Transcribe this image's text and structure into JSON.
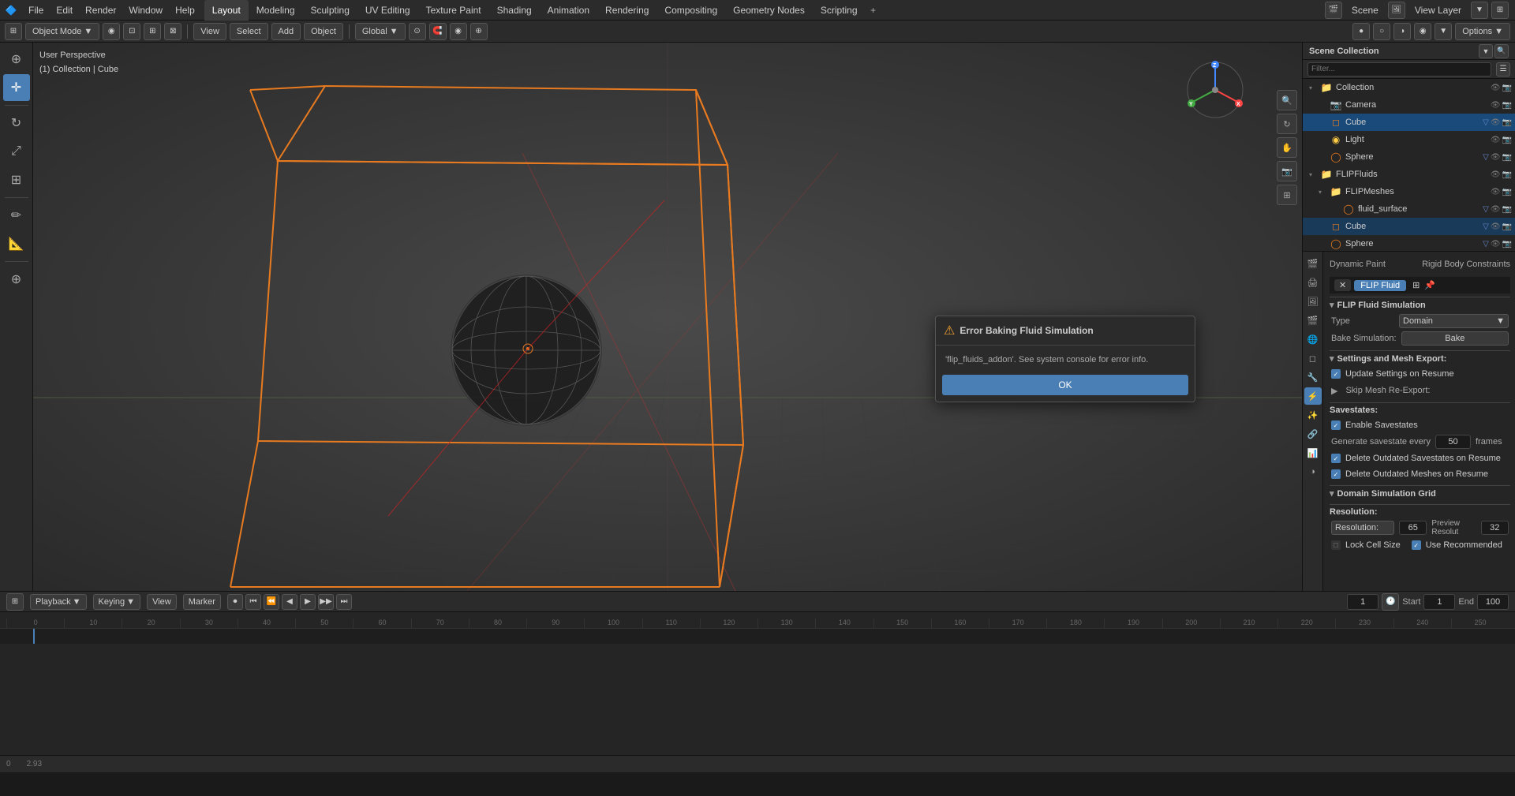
{
  "topMenu": {
    "menus": [
      "File",
      "Edit",
      "Render",
      "Window",
      "Help"
    ],
    "tabs": [
      "Layout",
      "Modeling",
      "Sculpting",
      "UV Editing",
      "Texture Paint",
      "Shading",
      "Animation",
      "Rendering",
      "Compositing",
      "Geometry Nodes",
      "Scripting"
    ],
    "activeTab": "Layout",
    "addTabLabel": "+",
    "sceneName": "Scene",
    "viewLayerName": "View Layer"
  },
  "secondToolbar": {
    "objectMode": "Object Mode",
    "view": "View",
    "select": "Select",
    "add": "Add",
    "object": "Object",
    "global": "Global",
    "options": "Options"
  },
  "leftTools": [
    {
      "name": "cursor-tool",
      "icon": "⊕",
      "active": false
    },
    {
      "name": "move-tool",
      "icon": "✛",
      "active": true
    },
    {
      "name": "rotate-tool",
      "icon": "↻",
      "active": false
    },
    {
      "name": "scale-tool",
      "icon": "⤢",
      "active": false
    },
    {
      "name": "transform-tool",
      "icon": "⊞",
      "active": false
    },
    {
      "name": "annotate-tool",
      "icon": "✏",
      "active": false
    },
    {
      "name": "measure-tool",
      "icon": "📏",
      "active": false
    },
    {
      "name": "add-tool",
      "icon": "⊕",
      "active": false
    }
  ],
  "viewport": {
    "info": {
      "perspective": "User Perspective",
      "collection": "(1) Collection | Cube"
    }
  },
  "outliner": {
    "title": "Scene Collection",
    "items": [
      {
        "name": "Collection",
        "indent": 0,
        "icon": "📁",
        "hasArrow": true,
        "expanded": true
      },
      {
        "name": "Camera",
        "indent": 1,
        "icon": "📷",
        "hasArrow": false
      },
      {
        "name": "Cube",
        "indent": 1,
        "icon": "◻",
        "hasArrow": false,
        "selected": true,
        "highlighted": true
      },
      {
        "name": "Light",
        "indent": 1,
        "icon": "💡",
        "hasArrow": false
      },
      {
        "name": "Sphere",
        "indent": 1,
        "icon": "◯",
        "hasArrow": false
      },
      {
        "name": "FLIPFluids",
        "indent": 0,
        "icon": "📁",
        "hasArrow": true,
        "expanded": true
      },
      {
        "name": "FLIPMeshes",
        "indent": 1,
        "icon": "📁",
        "hasArrow": true,
        "expanded": true
      },
      {
        "name": "fluid_surface",
        "indent": 2,
        "icon": "◯",
        "hasArrow": false
      },
      {
        "name": "Cube",
        "indent": 1,
        "icon": "◻",
        "hasArrow": false,
        "selected2": true
      },
      {
        "name": "Sphere",
        "indent": 1,
        "icon": "◯",
        "hasArrow": false
      }
    ]
  },
  "properties": {
    "sections": {
      "dynamicPaint": "Dynamic Paint",
      "rigidBodyConstraints": "Rigid Body Constraints",
      "flipFluidLabel": "FLIP Fluid",
      "flipFluidSimulation": "FLIP Fluid Simulation",
      "type": "Type",
      "typeValue": "Domain",
      "bakeSimulation": "Bake Simulation:",
      "bakeBtn": "Bake",
      "settingsMeshExport": "Settings and Mesh Export:",
      "updateSettings": "Update Settings on Resume",
      "skipMeshReExport": "Skip Mesh Re-Export:",
      "savestates": "Savestates:",
      "enableSavestates": "Enable Savestates",
      "generateSavestate": "Generate savestate every",
      "savestateFrames": "50",
      "framesLabel": "frames",
      "deleteOutdatedSavestates": "Delete Outdated Savestates on Resume",
      "deleteOutdatedMeshes": "Delete Outdated Meshes on Resume",
      "domainSimGrid": "Domain Simulation Grid",
      "resolution": "Resolution:",
      "resolutionValue": "65",
      "previewResolution": "Preview Resolut",
      "previewResolutionValue": "32",
      "lockCellSize": "Lock Cell Size",
      "useRecommended": "Use Recommended"
    }
  },
  "errorDialog": {
    "title": "Error Baking Fluid Simulation",
    "message": "'flip_fluids_addon'. See system console for error info.",
    "okLabel": "OK"
  },
  "timeline": {
    "playbackLabel": "Playback",
    "keyingLabel": "Keying",
    "viewLabel": "View",
    "markerLabel": "Marker",
    "currentFrame": "1",
    "startLabel": "Start",
    "startFrame": "1",
    "endLabel": "End",
    "endFrame": "100",
    "rulerMarks": [
      "0",
      "10",
      "20",
      "30",
      "40",
      "50",
      "60",
      "70",
      "80",
      "90",
      "100",
      "110",
      "120",
      "130",
      "140",
      "150",
      "160",
      "170",
      "180",
      "190",
      "200",
      "210",
      "220",
      "230",
      "240",
      "250"
    ],
    "fps": "2.93"
  },
  "statusBar": {
    "vertices": "0",
    "fps": "2.93"
  }
}
